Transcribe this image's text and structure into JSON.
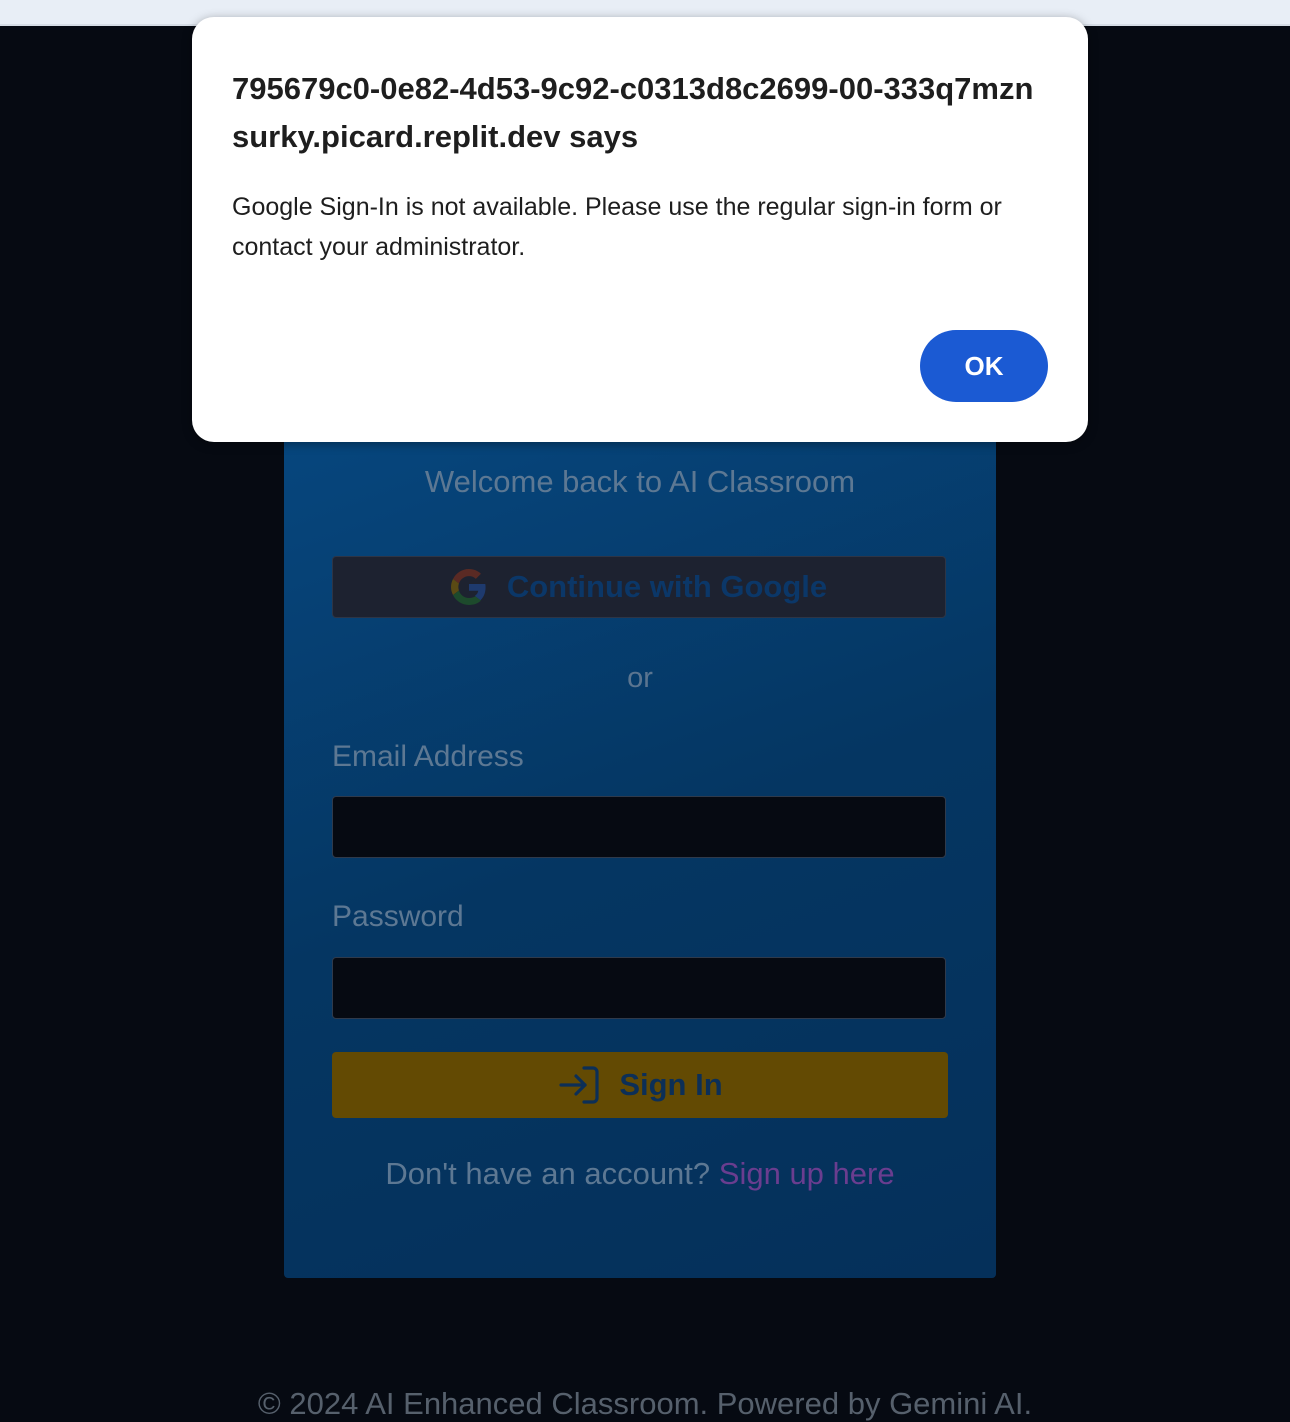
{
  "dialog": {
    "title": "795679c0-0e82-4d53-9c92-c0313d8c2699-00-333q7mznsurky.picard.replit.dev says",
    "message": "Google Sign-In is not available. Please use the regular sign-in form or contact your administrator.",
    "ok_label": "OK"
  },
  "login": {
    "welcome": "Welcome back to AI Classroom",
    "google_label": "Continue with Google",
    "or": "or",
    "email_label": "Email Address",
    "email_value": "",
    "password_label": "Password",
    "password_value": "",
    "signin_label": "Sign In",
    "signup_prompt": "Don't have an account?",
    "signup_link": "Sign up here"
  },
  "footer": {
    "text": "© 2024 AI Enhanced Classroom. Powered by Gemini AI."
  },
  "colors": {
    "accent_blue": "#1b5ad3",
    "card_blue": "#053662",
    "signin_gold": "#634a03",
    "signup_link": "#6a3d8f"
  }
}
